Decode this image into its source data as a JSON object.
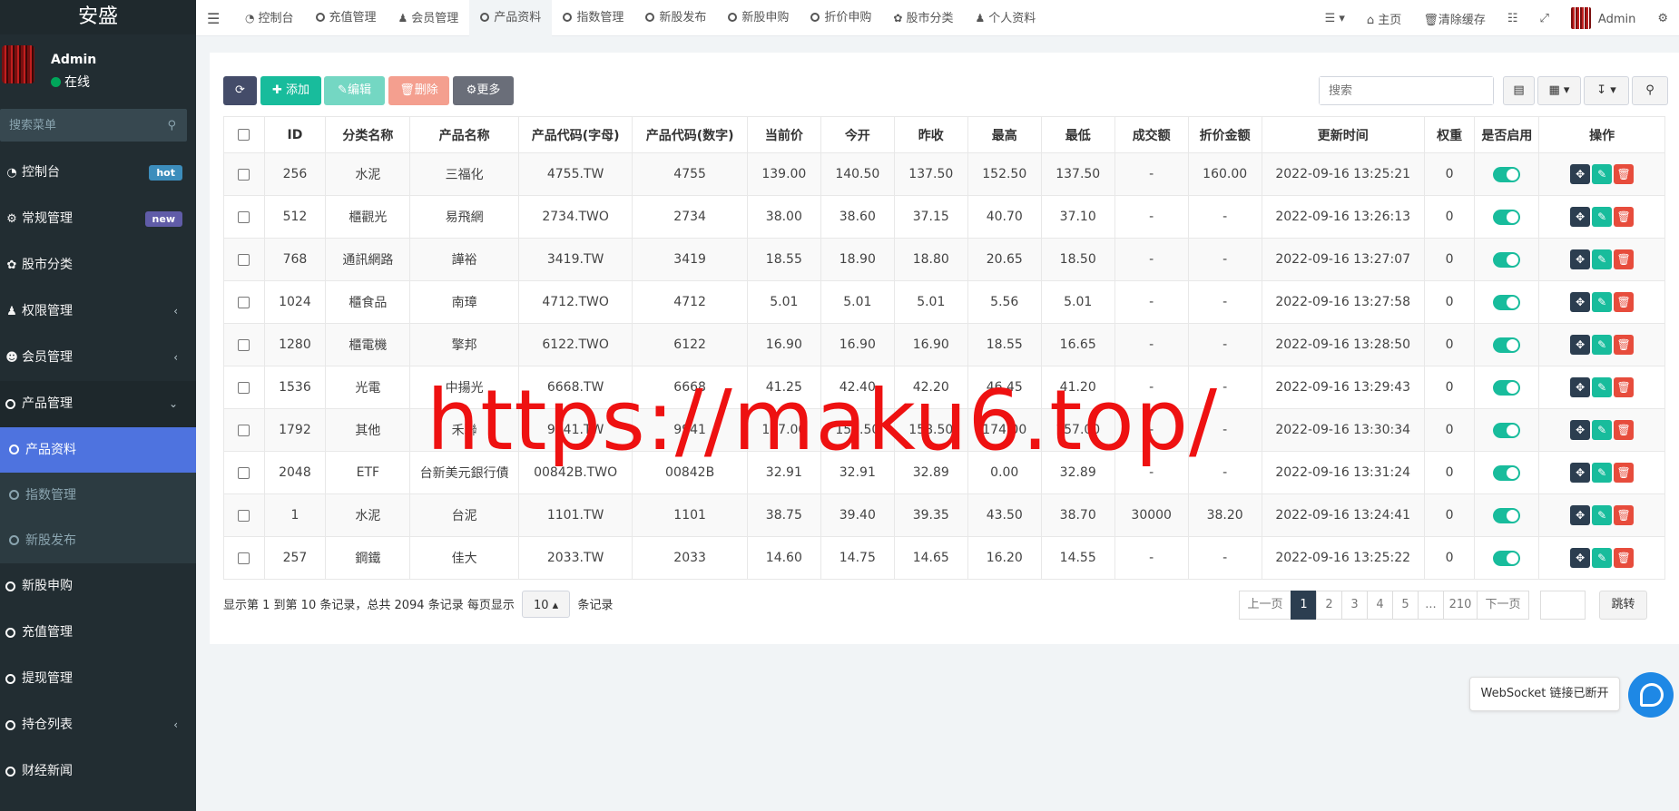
{
  "sidebar": {
    "brand": "安盛",
    "user_name": "Admin",
    "user_status": "在线",
    "search_placeholder": "搜索菜单",
    "items": [
      {
        "label": "控制台",
        "badge": "hot"
      },
      {
        "label": "常规管理",
        "badge": "new"
      },
      {
        "label": "股市分类"
      },
      {
        "label": "权限管理"
      },
      {
        "label": "会员管理"
      },
      {
        "label": "产品管理"
      },
      {
        "label": "新股申购"
      },
      {
        "label": "充值管理"
      },
      {
        "label": "提现管理"
      },
      {
        "label": "持仓列表"
      },
      {
        "label": "财经新闻"
      }
    ],
    "sub_items": [
      {
        "label": "产品资料"
      },
      {
        "label": "指数管理"
      },
      {
        "label": "新股发布"
      }
    ]
  },
  "topbar": {
    "tabs": [
      {
        "label": "控制台",
        "icon": "dashboard-icon"
      },
      {
        "label": "充值管理",
        "icon": "circle-icon"
      },
      {
        "label": "会员管理",
        "icon": "user-icon"
      },
      {
        "label": "产品资料",
        "icon": "circle-icon"
      },
      {
        "label": "指数管理",
        "icon": "circle-icon"
      },
      {
        "label": "新股发布",
        "icon": "circle-icon"
      },
      {
        "label": "新股申购",
        "icon": "circle-icon"
      },
      {
        "label": "折价申购",
        "icon": "circle-icon"
      },
      {
        "label": "股市分类",
        "icon": "leaf-icon"
      },
      {
        "label": "个人资料",
        "icon": "user-icon"
      }
    ],
    "home": "主页",
    "clear_cache": "清除缓存",
    "admin": "Admin"
  },
  "toolbar": {
    "add": "添加",
    "edit": "编辑",
    "delete": "删除",
    "more": "更多",
    "search_placeholder": "搜索"
  },
  "table": {
    "headers": [
      "ID",
      "分类名称",
      "产品名称",
      "产品代码(字母)",
      "产品代码(数字)",
      "当前价",
      "今开",
      "昨收",
      "最高",
      "最低",
      "成交额",
      "折价金额",
      "更新时间",
      "权重",
      "是否启用",
      "操作"
    ],
    "rows": [
      [
        "256",
        "水泥",
        "三福化",
        "4755.TW",
        "4755",
        "139.00",
        "140.50",
        "137.50",
        "152.50",
        "137.50",
        "-",
        "160.00",
        "2022-09-16 13:25:21",
        "0"
      ],
      [
        "512",
        "櫃觀光",
        "易飛網",
        "2734.TWO",
        "2734",
        "38.00",
        "38.60",
        "37.15",
        "40.70",
        "37.10",
        "-",
        "-",
        "2022-09-16 13:26:13",
        "0"
      ],
      [
        "768",
        "通訊網路",
        "譁裕",
        "3419.TW",
        "3419",
        "18.55",
        "18.90",
        "18.80",
        "20.65",
        "18.50",
        "-",
        "-",
        "2022-09-16 13:27:07",
        "0"
      ],
      [
        "1024",
        "櫃食品",
        "南璋",
        "4712.TWO",
        "4712",
        "5.01",
        "5.01",
        "5.01",
        "5.56",
        "5.01",
        "-",
        "-",
        "2022-09-16 13:27:58",
        "0"
      ],
      [
        "1280",
        "櫃電機",
        "擎邦",
        "6122.TWO",
        "6122",
        "16.90",
        "16.90",
        "16.90",
        "18.55",
        "16.65",
        "-",
        "-",
        "2022-09-16 13:28:50",
        "0"
      ],
      [
        "1536",
        "光電",
        "中揚光",
        "6668.TW",
        "6668",
        "41.25",
        "42.40",
        "42.20",
        "46.45",
        "41.20",
        "-",
        "-",
        "2022-09-16 13:29:43",
        "0"
      ],
      [
        "1792",
        "其他",
        "禾聯",
        "9941.TW",
        "9941",
        "157.00",
        "158.50",
        "158.50",
        "174.00",
        "157.00",
        "-",
        "-",
        "2022-09-16 13:30:34",
        "0"
      ],
      [
        "2048",
        "ETF",
        "台新美元銀行債",
        "00842B.TWO",
        "00842B",
        "32.91",
        "32.91",
        "32.89",
        "0.00",
        "32.89",
        "-",
        "-",
        "2022-09-16 13:31:24",
        "0"
      ],
      [
        "1",
        "水泥",
        "台泥",
        "1101.TW",
        "1101",
        "38.75",
        "39.40",
        "39.35",
        "43.50",
        "38.70",
        "30000",
        "38.20",
        "2022-09-16 13:24:41",
        "0"
      ],
      [
        "257",
        "鋼鐵",
        "佳大",
        "2033.TW",
        "2033",
        "14.60",
        "14.75",
        "14.65",
        "16.20",
        "14.55",
        "-",
        "-",
        "2022-09-16 13:25:22",
        "0"
      ]
    ]
  },
  "pager": {
    "info_prefix": "显示第 1 到第 10 条记录，总共 2094 条记录 每页显示",
    "page_size": "10",
    "info_suffix": "条记录",
    "prev": "上一页",
    "pages": [
      "1",
      "2",
      "3",
      "4",
      "5",
      "...",
      "210"
    ],
    "next": "下一页",
    "goto": "跳转"
  },
  "watermark": "https://maku6.top/",
  "ws_toast": "WebSocket 链接已断开",
  "colors": {
    "sidebar_bg": "#222d32",
    "active_menu": "#4e73df",
    "success": "#18bc9c",
    "danger": "#e74c3c",
    "primary_dark": "#2c3e50"
  }
}
